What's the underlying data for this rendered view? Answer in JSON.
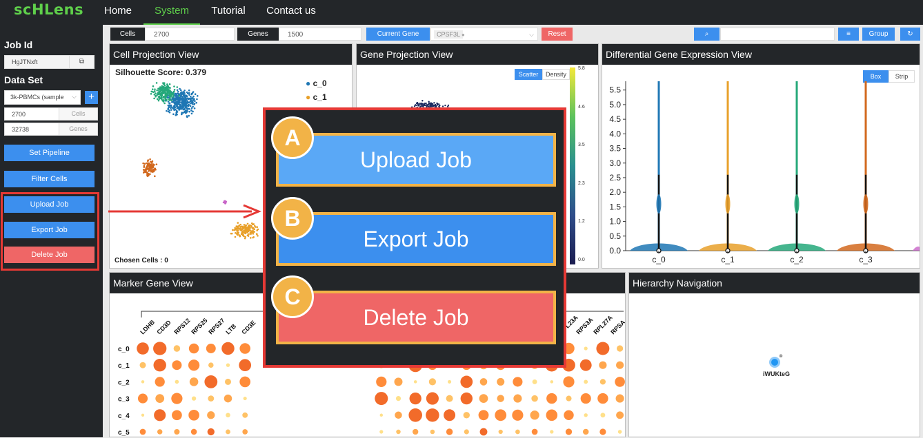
{
  "app": {
    "logo": "scHLens"
  },
  "nav": {
    "items": [
      "Home",
      "System",
      "Tutorial",
      "Contact us"
    ]
  },
  "sidebar": {
    "job_id_title": "Job Id",
    "job_id": "HgJTNxft",
    "dataset_title": "Data Set",
    "dataset": "3k-PBMCs (sample",
    "cells_value": "2700",
    "cells_label": "Cells",
    "genes_value": "32738",
    "genes_label": "Genes",
    "set_pipeline": "Set Pipeline",
    "filter_cells": "Filter Cells",
    "upload_job": "Upload Job",
    "export_job": "Export Job",
    "delete_job": "Delete Job"
  },
  "toolbar": {
    "cells_label": "Cells",
    "cells_value": "2700",
    "genes_label": "Genes",
    "genes_value": "1500",
    "current_gene_label": "Current Gene",
    "current_gene_tag": "CPSF3L",
    "reset": "Reset",
    "group": "Group"
  },
  "cell_projection": {
    "title": "Cell Projection View",
    "silhouette": "Silhouette Score: 0.379",
    "legend": [
      "c_0",
      "c_1"
    ],
    "chosen": "Chosen Cells : 0",
    "colors": [
      "#1f77b4",
      "#ff7f0e"
    ]
  },
  "gene_projection": {
    "title": "Gene Projection View",
    "scatter": "Scatter",
    "density": "Density",
    "colorbar_ticks": [
      "5.8",
      "4.6",
      "3.5",
      "2.3",
      "1.2",
      "0.0"
    ]
  },
  "dge": {
    "title": "Differential Gene Expression View",
    "box": "Box",
    "strip": "Strip"
  },
  "marker": {
    "title": "Marker Gene View",
    "genes": [
      "LDHB",
      "CD3D",
      "RPS12",
      "RPS25",
      "RPS27",
      "LTB",
      "CD3E",
      "RPL23A",
      "RPS3A",
      "RPL27A",
      "RPSA"
    ],
    "rows": [
      "c_0",
      "c_1",
      "c_2",
      "c_3",
      "c_4",
      "c_5"
    ]
  },
  "hierarchy": {
    "title": "Hierarchy Navigation",
    "node_label": "iWUKteG"
  },
  "overlay": {
    "letters": [
      "A",
      "B",
      "C"
    ],
    "upload": "Upload Job",
    "export": "Export Job",
    "delete": "Delete Job"
  },
  "chart_data": {
    "type": "violin",
    "categories": [
      "c_0",
      "c_1",
      "c_2",
      "c_3"
    ],
    "ylim": [
      0,
      5.8
    ],
    "yticks": [
      0.0,
      0.5,
      1.0,
      1.5,
      2.0,
      2.5,
      3.0,
      3.5,
      4.0,
      4.5,
      5.0,
      5.5
    ],
    "max_values": [
      5.8,
      5.8,
      5.8,
      5.8
    ],
    "median": [
      0,
      0,
      0,
      0
    ],
    "colors": [
      "#1f77b4",
      "#e8a02a",
      "#25a87a",
      "#d2691e"
    ]
  }
}
